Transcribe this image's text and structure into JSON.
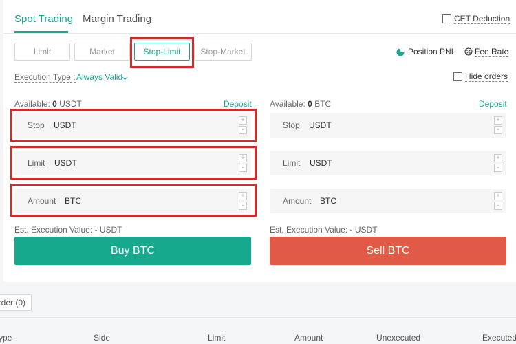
{
  "tabs": {
    "spot": "Spot Trading",
    "margin": "Margin Trading"
  },
  "cet_deduction": "CET Deduction",
  "order_types": [
    "Limit",
    "Market",
    "Stop-Limit",
    "Stop-Market"
  ],
  "position_pnl": "Position PNL",
  "fee_rate": "Fee Rate",
  "execution_type": {
    "label": "Execution Type :",
    "value": "Always Valid"
  },
  "hide_orders": "Hide orders",
  "buy": {
    "available_label": "Available:",
    "available_value": "0",
    "available_unit": "USDT",
    "deposit": "Deposit",
    "stop": {
      "label": "Stop",
      "unit": "USDT"
    },
    "limit": {
      "label": "Limit",
      "unit": "USDT"
    },
    "amount": {
      "label": "Amount",
      "unit": "BTC"
    },
    "est_label": "Est. Execution Value:",
    "est_value": "-",
    "est_unit": "USDT",
    "button": "Buy BTC"
  },
  "sell": {
    "available_label": "Available:",
    "available_value": "0",
    "available_unit": "BTC",
    "deposit": "Deposit",
    "stop": {
      "label": "Stop",
      "unit": "USDT"
    },
    "limit": {
      "label": "Limit",
      "unit": "USDT"
    },
    "amount": {
      "label": "Amount",
      "unit": "BTC"
    },
    "est_label": "Est. Execution Value:",
    "est_value": "-",
    "est_unit": "USDT",
    "button": "Sell BTC"
  },
  "stepper": {
    "plus": "+",
    "minus": "-"
  },
  "orders": {
    "tab": "rder (0)",
    "columns": [
      "ype",
      "Side",
      "Limit",
      "Amount",
      "Unexecuted",
      "Executed"
    ]
  },
  "colors": {
    "accent": "#1aa792",
    "buy": "#17a98e",
    "sell": "#e05a45",
    "highlight": "#d42a2a"
  }
}
